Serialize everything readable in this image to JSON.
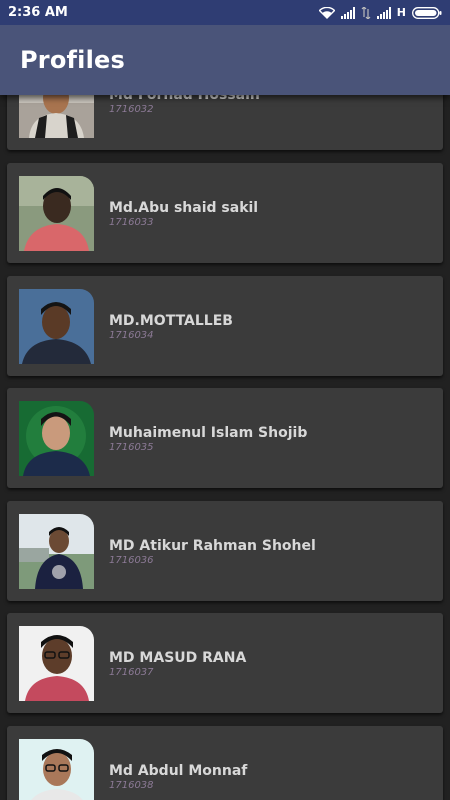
{
  "status_bar": {
    "time": "2:36 AM",
    "network_label": "H",
    "icons": [
      "wifi-icon",
      "signal-icon",
      "data-arrows-icon",
      "signal-icon",
      "battery-icon"
    ]
  },
  "app_bar": {
    "title": "Profiles"
  },
  "colors": {
    "status_bar": "#2f3d73",
    "app_bar": "#4a5479",
    "background": "#212121",
    "card": "#3b3b3b",
    "name_text": "#d8d8d8",
    "roll_text": "#8c7a96"
  },
  "profiles": [
    {
      "name": "Md Forhad Hossain",
      "roll": "1716032"
    },
    {
      "name": "Md.Abu shaid sakil",
      "roll": "1716033"
    },
    {
      "name": "MD.MOTTALLEB",
      "roll": "1716034"
    },
    {
      "name": "Muhaimenul Islam Shojib",
      "roll": "1716035"
    },
    {
      "name": "MD Atikur Rahman Shohel",
      "roll": "1716036"
    },
    {
      "name": "MD MASUD RANA",
      "roll": "1716037"
    },
    {
      "name": "Md Abdul Monnaf",
      "roll": "1716038"
    }
  ]
}
